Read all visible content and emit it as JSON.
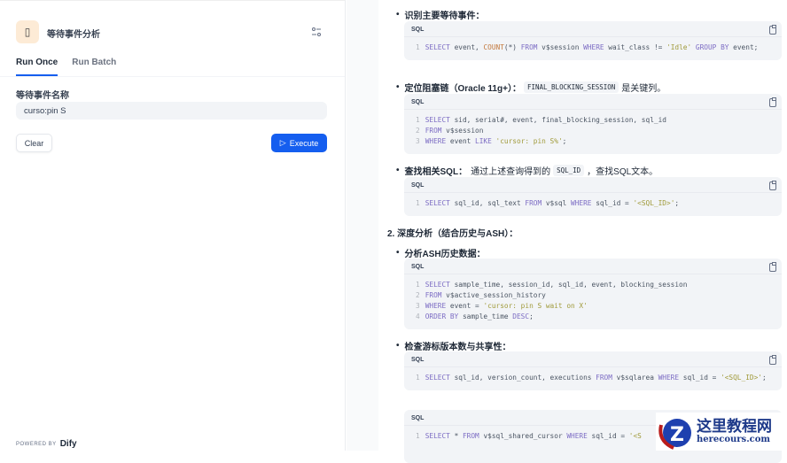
{
  "app": {
    "title": "等待事件分析",
    "icon": "app-emoji-icon"
  },
  "tabs": [
    {
      "label": "Run Once",
      "active": true
    },
    {
      "label": "Run Batch",
      "active": false
    }
  ],
  "form": {
    "field_label": "等待事件名称",
    "field_value": "curso:pin S",
    "clear": "Clear",
    "execute": "Execute"
  },
  "footer": {
    "powered": "POWERED BY",
    "brand": "Dify"
  },
  "result": {
    "b1": "识别主要等待事件：",
    "b2_bold": "定位阻塞链（Oracle 11g+）：",
    "b2_code": "FINAL_BLOCKING_SESSION",
    "b2_rest": "是关键列。",
    "b3_bold": "查找相关SQL：",
    "b3_text": "通过上述查询得到的",
    "b3_code": "SQL_ID",
    "b3_rest": "，查找SQL文本。",
    "h2": "2. 深度分析（结合历史与ASH）：",
    "b4": "分析ASH历史数据：",
    "b5": "检查游标版本数与共享性：",
    "lang": "SQL",
    "codes": [
      [
        [
          [
            "k",
            "SELECT"
          ],
          [
            "t",
            " event, "
          ],
          [
            "f",
            "COUNT"
          ],
          [
            "t",
            "(*) "
          ],
          [
            "k",
            "FROM"
          ],
          [
            "t",
            " v$session "
          ],
          [
            "k",
            "WHERE"
          ],
          [
            "t",
            " wait_class != "
          ],
          [
            "s",
            "'Idle'"
          ],
          [
            "t",
            " "
          ],
          [
            "k",
            "GROUP BY"
          ],
          [
            "t",
            " event;"
          ]
        ]
      ],
      [
        [
          [
            "k",
            "SELECT"
          ],
          [
            "t",
            " sid, serial#, event, final_blocking_session, sql_id"
          ]
        ],
        [
          [
            "k",
            "FROM"
          ],
          [
            "t",
            " v$session"
          ]
        ],
        [
          [
            "k",
            "WHERE"
          ],
          [
            "t",
            " event "
          ],
          [
            "k",
            "LIKE"
          ],
          [
            "t",
            " "
          ],
          [
            "s",
            "'cursor: pin S%'"
          ],
          [
            "t",
            ";"
          ]
        ]
      ],
      [
        [
          [
            "k",
            "SELECT"
          ],
          [
            "t",
            " sql_id, sql_text "
          ],
          [
            "k",
            "FROM"
          ],
          [
            "t",
            " v$sql "
          ],
          [
            "k",
            "WHERE"
          ],
          [
            "t",
            " sql_id = "
          ],
          [
            "s",
            "'<SQL_ID>'"
          ],
          [
            "t",
            ";"
          ]
        ]
      ],
      [
        [
          [
            "k",
            "SELECT"
          ],
          [
            "t",
            " sample_time, session_id, sql_id, event, blocking_session"
          ]
        ],
        [
          [
            "k",
            "FROM"
          ],
          [
            "t",
            " v$active_session_history"
          ]
        ],
        [
          [
            "k",
            "WHERE"
          ],
          [
            "t",
            " event = "
          ],
          [
            "s",
            "'cursor: pin S wait on X'"
          ]
        ],
        [
          [
            "k",
            "ORDER BY"
          ],
          [
            "t",
            " sample_time "
          ],
          [
            "k",
            "DESC"
          ],
          [
            "t",
            ";"
          ]
        ]
      ],
      [
        [
          [
            "k",
            "SELECT"
          ],
          [
            "t",
            " sql_id, version_count, executions "
          ],
          [
            "k",
            "FROM"
          ],
          [
            "t",
            " v$sqlarea "
          ],
          [
            "k",
            "WHERE"
          ],
          [
            "t",
            " sql_id = "
          ],
          [
            "s",
            "'<SQL_ID>'"
          ],
          [
            "t",
            ";"
          ]
        ]
      ],
      [
        [
          [
            "k",
            "SELECT"
          ],
          [
            "t",
            " * "
          ],
          [
            "k",
            "FROM"
          ],
          [
            "t",
            " v$sql_shared_cursor "
          ],
          [
            "k",
            "WHERE"
          ],
          [
            "t",
            " sql_id = "
          ],
          [
            "s",
            "'<S"
          ]
        ]
      ]
    ]
  },
  "watermark": {
    "title": "这里教程网",
    "url": "herecours.com"
  }
}
